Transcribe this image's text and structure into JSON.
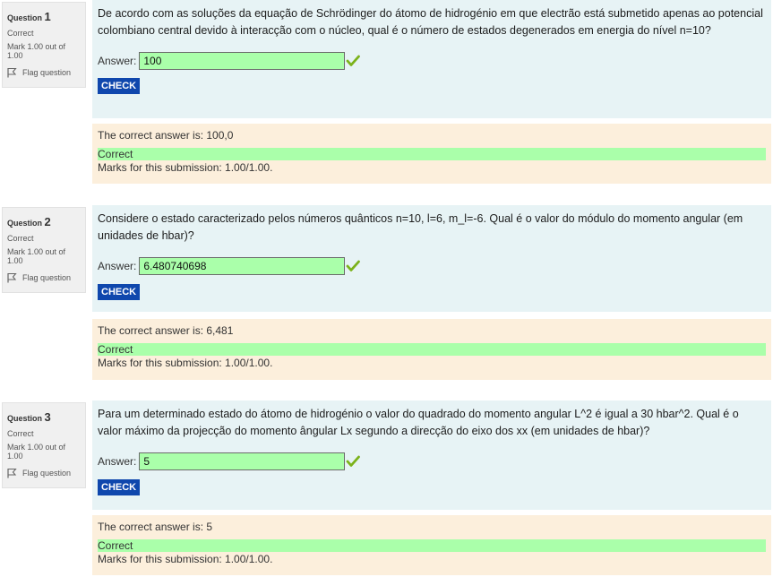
{
  "questions": [
    {
      "label": "Question",
      "number": "1",
      "state": "Correct",
      "mark": "Mark 1.00 out of 1.00",
      "flag": "Flag question",
      "text": "De acordo com as soluções da equação de Schrödinger do átomo de hidrogénio em que electrão está submetido apenas ao potencial colombiano central devido à interacção com o núcleo, qual é o número de estados degenerados em energia do nível n=10?",
      "answer_label": "Answer:",
      "answer_value": "100",
      "check_label": "CHECK",
      "correct_answer": "The correct answer is: 100,0",
      "result": "Correct",
      "marks": "Marks for this submission: 1.00/1.00."
    },
    {
      "label": "Question",
      "number": "2",
      "state": "Correct",
      "mark": "Mark 1.00 out of 1.00",
      "flag": "Flag question",
      "text": "Considere o estado caracterizado pelos números quânticos n=10, l=6, m_l=-6. Qual é o valor do módulo do momento angular (em unidades de hbar)?",
      "answer_label": "Answer:",
      "answer_value": "6.480740698",
      "check_label": "CHECK",
      "correct_answer": "The correct answer is: 6,481",
      "result": "Correct",
      "marks": "Marks for this submission: 1.00/1.00."
    },
    {
      "label": "Question",
      "number": "3",
      "state": "Correct",
      "mark": "Mark 1.00 out of 1.00",
      "flag": "Flag question",
      "text": "Para um determinado estado do átomo de hidrogénio o valor do quadrado do momento angular L^2 é igual a 30 hbar^2. Qual é o valor máximo da projecção do momento ângular Lx segundo a direcção do eixo dos xx (em unidades de hbar)?",
      "answer_label": "Answer:",
      "answer_value": "5",
      "check_label": "CHECK",
      "correct_answer": "The correct answer is: 5",
      "result": "Correct",
      "marks": "Marks for this submission: 1.00/1.00."
    }
  ],
  "colors": {
    "correct_bg": "#aaffaa",
    "formulation_bg": "#e7f3f5",
    "feedback_bg": "#fcefdc",
    "button_bg": "#0f47ad",
    "checkmark": "#7bb21a"
  }
}
